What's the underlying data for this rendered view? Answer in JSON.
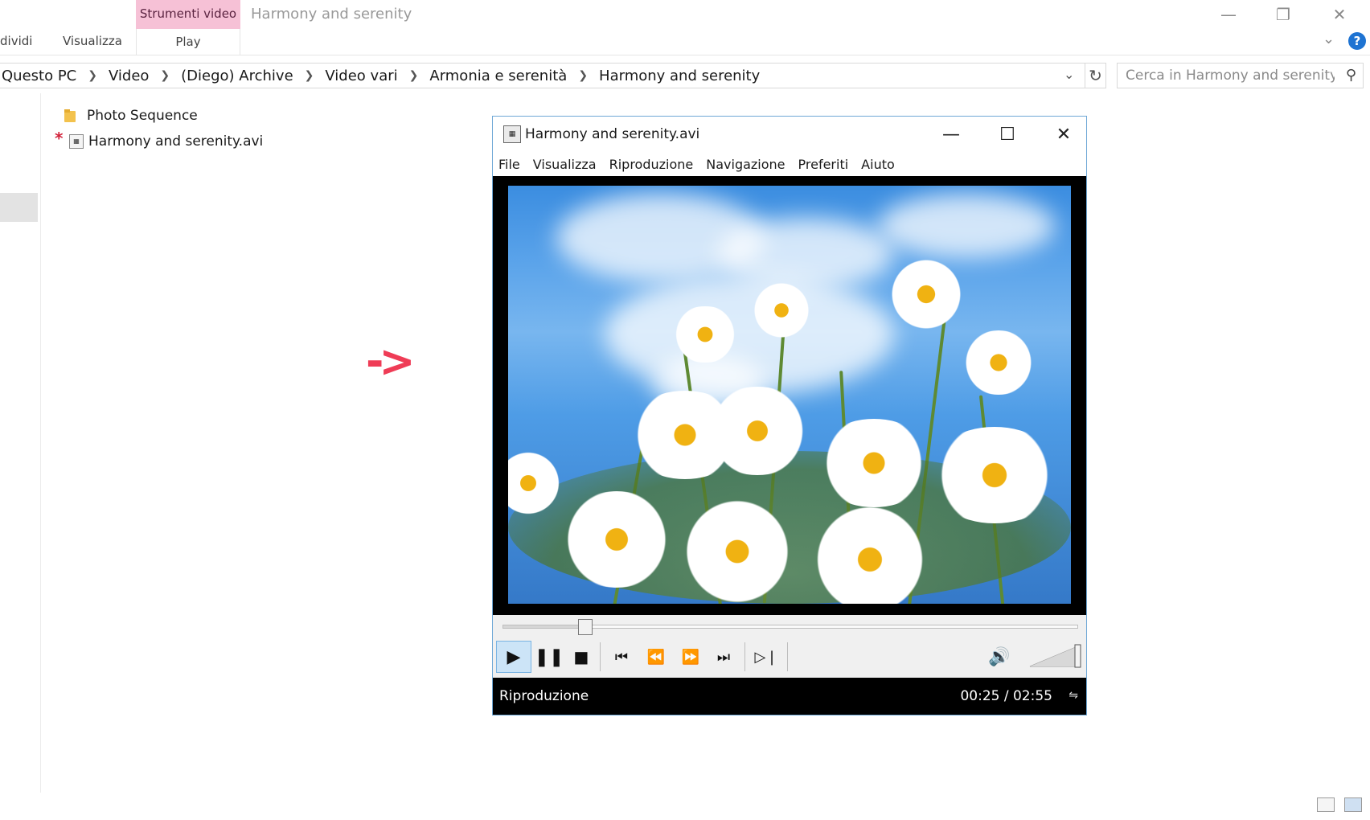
{
  "explorer": {
    "ribbon": {
      "tab_share": "dividi",
      "tab_view": "Visualizza",
      "context_group": "Strumenti video",
      "context_tab": "Play"
    },
    "window_title": "Harmony and serenity",
    "address": {
      "crumbs": [
        "Questo PC",
        "Video",
        "(Diego) Archive",
        "Video vari",
        "Armonia e serenità",
        "Harmony and serenity"
      ]
    },
    "search": {
      "placeholder": "Cerca in Harmony and serenity"
    },
    "files": [
      {
        "name": "Photo Sequence",
        "type": "folder"
      },
      {
        "name": "Harmony and serenity.avi",
        "type": "video"
      }
    ],
    "annotation_arrow": "->",
    "annotation_star": "*"
  },
  "player": {
    "title": "Harmony and serenity.avi",
    "menu": [
      "File",
      "Visualizza",
      "Riproduzione",
      "Navigazione",
      "Preferiti",
      "Aiuto"
    ],
    "status": "Riproduzione",
    "time": "00:25 / 02:55",
    "progress_fraction": 0.143,
    "volume_fraction": 1.0
  },
  "icons": {
    "minimize": "minimize-icon",
    "maximize": "maximize-icon",
    "close": "close-icon",
    "help": "help-icon",
    "refresh": "refresh-icon",
    "search": "search-icon"
  },
  "colors": {
    "context_tab": "#f6c1d6",
    "accent": "#1e73d2",
    "annotation": "#ef3c56",
    "play_active": "#cce4f7"
  }
}
